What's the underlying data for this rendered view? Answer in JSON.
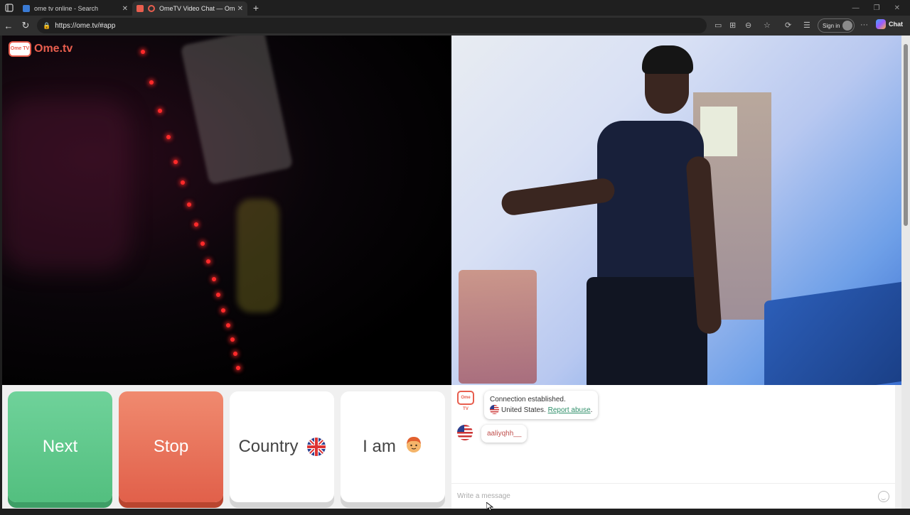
{
  "browser": {
    "tabs": [
      {
        "title": "ome tv online - Search",
        "active": false
      },
      {
        "title": "OmeTV Video Chat — Omegle",
        "active": true
      }
    ],
    "url": "https://ome.tv/#app",
    "signin_label": "Sign in",
    "chat_label": "Chat"
  },
  "app": {
    "logo_text": "Ome.tv",
    "logo_badge": "Ome TV"
  },
  "controls": {
    "next_label": "Next",
    "stop_label": "Stop",
    "country_label": "Country",
    "iam_label": "I am"
  },
  "chat": {
    "system_message": "Connection established.",
    "country": "United States.",
    "report_label": "Report abuse",
    "report_suffix": ".",
    "stranger_message": "aaliyqhh__",
    "input_placeholder": "Write a message"
  },
  "colors": {
    "next": "#5fc98b",
    "stop": "#e8705a",
    "brand": "#e85e4e",
    "link": "#2f8f6a"
  },
  "icons": [
    "menu-icon",
    "search-icon",
    "ometv-favicon",
    "close-icon",
    "plus-icon",
    "back-icon",
    "refresh-icon",
    "lock-icon",
    "camera-icon",
    "split-icon",
    "block-icon",
    "star-icon",
    "extensions-icon",
    "favorites-icon",
    "more-icon",
    "copilot-icon",
    "uk-flag-icon",
    "boy-emoji-icon",
    "us-flag-icon",
    "smiley-icon"
  ]
}
